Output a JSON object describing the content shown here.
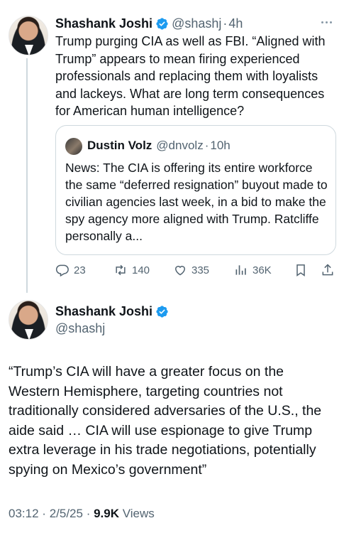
{
  "colors": {
    "verified": "#1d9bf0",
    "text": "#0f1419",
    "muted": "#536471",
    "border": "#cfd9de"
  },
  "parent_tweet": {
    "author_name": "Shashank Joshi",
    "handle": "@shashj",
    "separator": "·",
    "time": "4h",
    "text": "Trump purging CIA as well as FBI. “Aligned with Trump” appears to mean firing experienced professionals and replacing them with loyalists and lackeys. What are long term consequences for American human intelligence?",
    "quote": {
      "author_name": "Dustin Volz",
      "handle": "@dnvolz",
      "separator": "·",
      "time": "10h",
      "text": "News: The CIA is offering its entire workforce the same “deferred resignation” buyout made to civilian agencies last week, in a bid to make the spy agency more aligned with Trump. Ratcliffe personally a..."
    },
    "actions": {
      "replies": "23",
      "reposts": "140",
      "likes": "335",
      "views": "36K"
    },
    "icons": [
      "verified-badge-icon",
      "more-icon",
      "reply-icon",
      "repost-icon",
      "like-icon",
      "views-icon",
      "bookmark-icon",
      "share-icon"
    ]
  },
  "main_tweet": {
    "author_name": "Shashank Joshi",
    "handle": "@shashj",
    "text": "“Trump’s CIA will have a greater focus on the Western Hemisphere, targeting countries not traditionally considered adversaries of the U.S., the aide said …  CIA will use espionage to give Trump extra leverage in his trade negotiations, potentially spying on Mexico’s government”",
    "time": "03:12",
    "separator": "·",
    "date": "2/5/25",
    "views_count": "9.9K",
    "views_label": "Views"
  }
}
